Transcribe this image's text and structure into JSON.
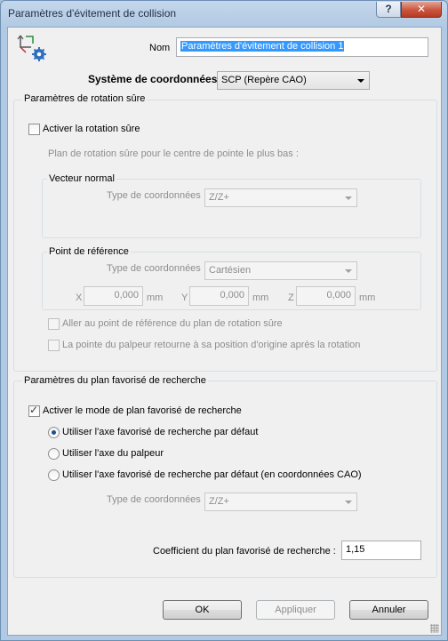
{
  "window": {
    "title": "Paramètres d'évitement de collision",
    "help_label": "?",
    "close_label": "✕"
  },
  "header": {
    "icon": "collision-settings-icon",
    "name_label": "Nom",
    "name_value": "Paramètres d'évitement de collision 1",
    "coord_system_label": "Système de coordonnées",
    "coord_system_value": "SCP (Repère CAO)"
  },
  "safe_rotation": {
    "group_title": "Paramètres de rotation sûre",
    "enable_label": "Activer la rotation sûre",
    "enable_checked": false,
    "plane_caption": "Plan de rotation sûre pour le centre de pointe le plus bas :",
    "normal_vector": {
      "title": "Vecteur normal",
      "coord_type_label": "Type de coordonnées",
      "coord_type_value": "Z/Z+"
    },
    "reference_point": {
      "title": "Point de référence",
      "coord_type_label": "Type de coordonnées",
      "coord_type_value": "Cartésien",
      "x_label": "X",
      "x_value": "0,000",
      "y_label": "Y",
      "y_value": "0,000",
      "z_label": "Z",
      "z_value": "0,000",
      "unit": "mm"
    },
    "goto_ref_label": "Aller au point de référence du plan de rotation sûre",
    "return_origin_label": "La pointe du palpeur retourne à sa position d'origine après la rotation"
  },
  "preferred_plane": {
    "group_title": "Paramètres du plan favorisé de recherche",
    "enable_label": "Activer le mode de plan favorisé de recherche",
    "enable_checked": true,
    "radio_default": "Utiliser l'axe favorisé de recherche par défaut",
    "radio_probe": "Utiliser l'axe du palpeur",
    "radio_cad": "Utiliser l'axe favorisé de recherche par défaut (en coordonnées CAO)",
    "selected_radio": "radio_default",
    "coord_type_label": "Type de coordonnées",
    "coord_type_value": "Z/Z+",
    "coefficient_label": "Coefficient du plan favorisé de recherche :",
    "coefficient_value": "1,15"
  },
  "buttons": {
    "ok": "OK",
    "apply": "Appliquer",
    "cancel": "Annuler"
  }
}
